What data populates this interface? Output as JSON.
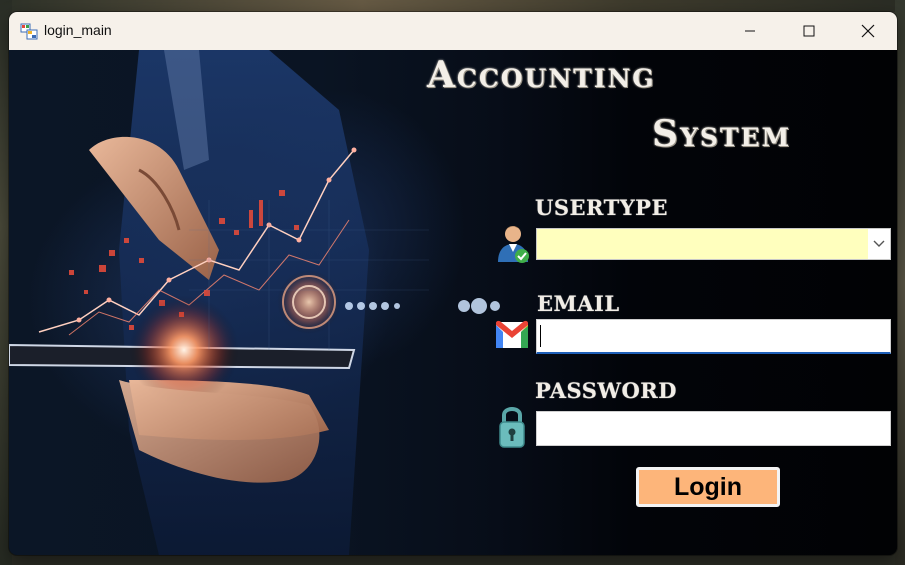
{
  "window": {
    "title": "login_main",
    "controls": {
      "minimize": "minimize-icon",
      "maximize": "maximize-icon",
      "close": "close-icon"
    }
  },
  "form": {
    "heading_line1": "Accounting",
    "heading_line2": "System",
    "usertype_label": "USERTYPE",
    "usertype_value": "",
    "email_label": "EMAIL",
    "email_value": "",
    "password_label": "PASSWORD",
    "password_value": "",
    "login_label": "Login"
  },
  "icons": {
    "usertype": "user-check-icon",
    "email": "gmail-icon",
    "password": "padlock-icon"
  },
  "colors": {
    "titlebar": "#f6f1ea",
    "combo_bg": "#ffffbe",
    "login_button": "#fdb57a",
    "focus_underline": "#1e5fb8"
  }
}
